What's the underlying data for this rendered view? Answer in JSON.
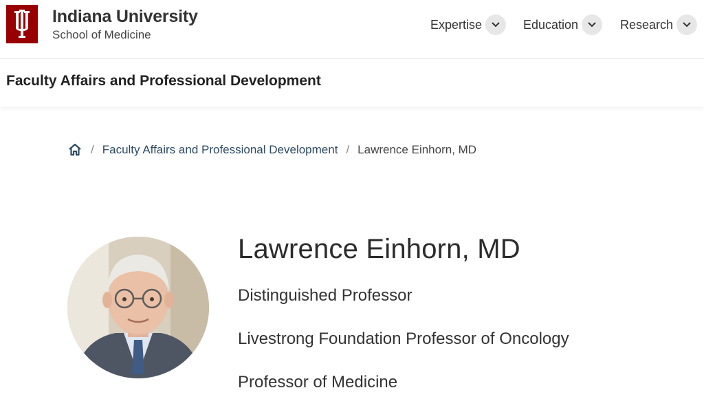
{
  "header": {
    "brand_title": "Indiana University",
    "brand_subtitle": "School of Medicine",
    "logo_icon": "iu-trident-logo",
    "accent_color": "#990000",
    "nav": [
      {
        "label": "Expertise",
        "icon": "chevron-down-icon"
      },
      {
        "label": "Education",
        "icon": "chevron-down-icon"
      },
      {
        "label": "Research",
        "icon": "chevron-down-icon"
      }
    ]
  },
  "section": {
    "title": "Faculty Affairs and Professional Development"
  },
  "breadcrumb": {
    "home_icon": "home-icon",
    "separator": "/",
    "link": "Faculty Affairs and Professional Development",
    "current": "Lawrence Einhorn, MD"
  },
  "profile": {
    "name": "Lawrence Einhorn, MD",
    "titles": [
      "Distinguished Professor",
      "Livestrong Foundation Professor of Oncology",
      "Professor of Medicine"
    ]
  }
}
